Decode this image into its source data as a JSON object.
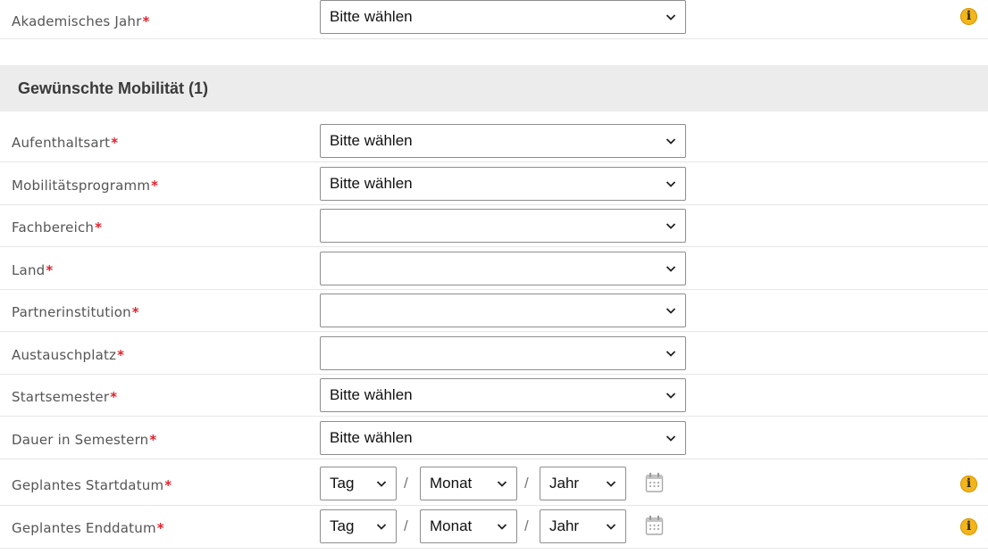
{
  "required_marker": "*",
  "info_icon_glyph": "i",
  "academic_year": {
    "label": "Akademisches Jahr",
    "value": "Bitte wählen"
  },
  "section": {
    "title": "Gewünschte Mobilität (1)"
  },
  "fields": [
    {
      "label": "Aufenthaltsart",
      "value": "Bitte wählen"
    },
    {
      "label": "Mobilitätsprogramm",
      "value": "Bitte wählen"
    },
    {
      "label": "Fachbereich",
      "value": ""
    },
    {
      "label": "Land",
      "value": ""
    },
    {
      "label": "Partnerinstitution",
      "value": ""
    },
    {
      "label": "Austauschplatz",
      "value": ""
    },
    {
      "label": "Startsemester",
      "value": "Bitte wählen"
    },
    {
      "label": "Dauer in Semestern",
      "value": "Bitte wählen"
    }
  ],
  "date_separator": "/",
  "start_date": {
    "label": "Geplantes Startdatum",
    "day": "Tag",
    "month": "Monat",
    "year": "Jahr"
  },
  "end_date": {
    "label": "Geplantes Enddatum",
    "day": "Tag",
    "month": "Monat",
    "year": "Jahr"
  },
  "icons": {
    "info": "info-icon",
    "chevron": "chevron-down-icon",
    "calendar": "calendar-icon"
  },
  "colors": {
    "required": "#e0232d",
    "info_badge": "#f2b51c",
    "section_bg": "#ececec"
  }
}
